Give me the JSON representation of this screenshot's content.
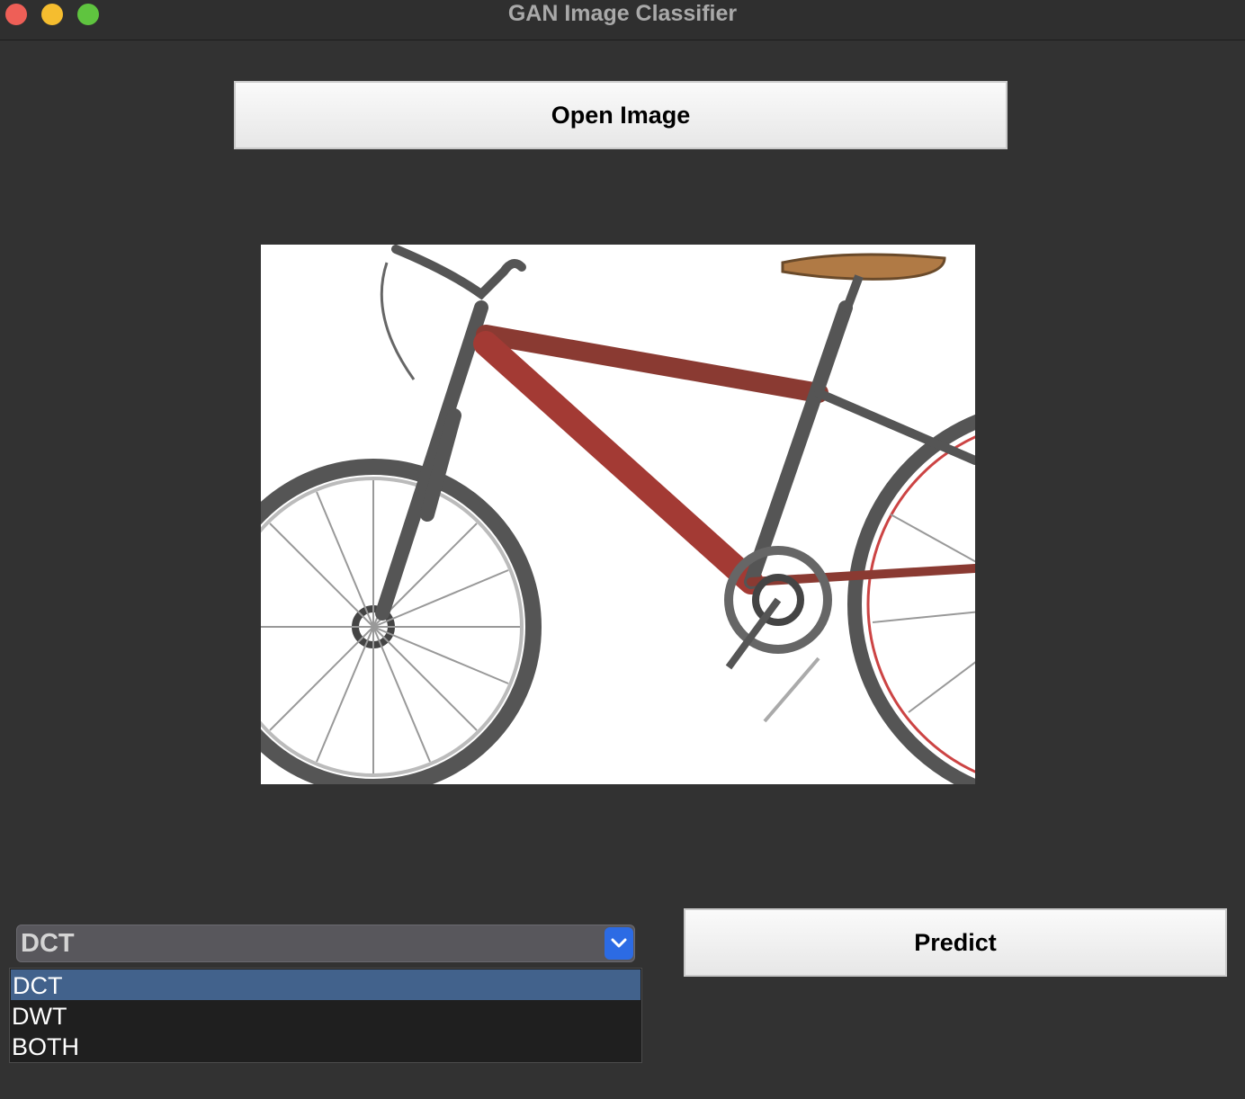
{
  "window": {
    "title": "GAN Image Classifier",
    "controls": [
      "close",
      "minimize",
      "zoom"
    ]
  },
  "open_button": {
    "label": "Open Image"
  },
  "image": {
    "subject": "bicycle-photo"
  },
  "method_select": {
    "selected": "DCT",
    "options": [
      "DCT",
      "DWT",
      "BOTH"
    ],
    "highlighted_option": "DCT",
    "arrow_icon": "chevron-down-icon",
    "accent_color": "#2c6be4"
  },
  "predict_button": {
    "label": "Predict"
  },
  "colors": {
    "background": "#323232",
    "button_face": "#f0f0f0",
    "highlight": "#42628c"
  }
}
